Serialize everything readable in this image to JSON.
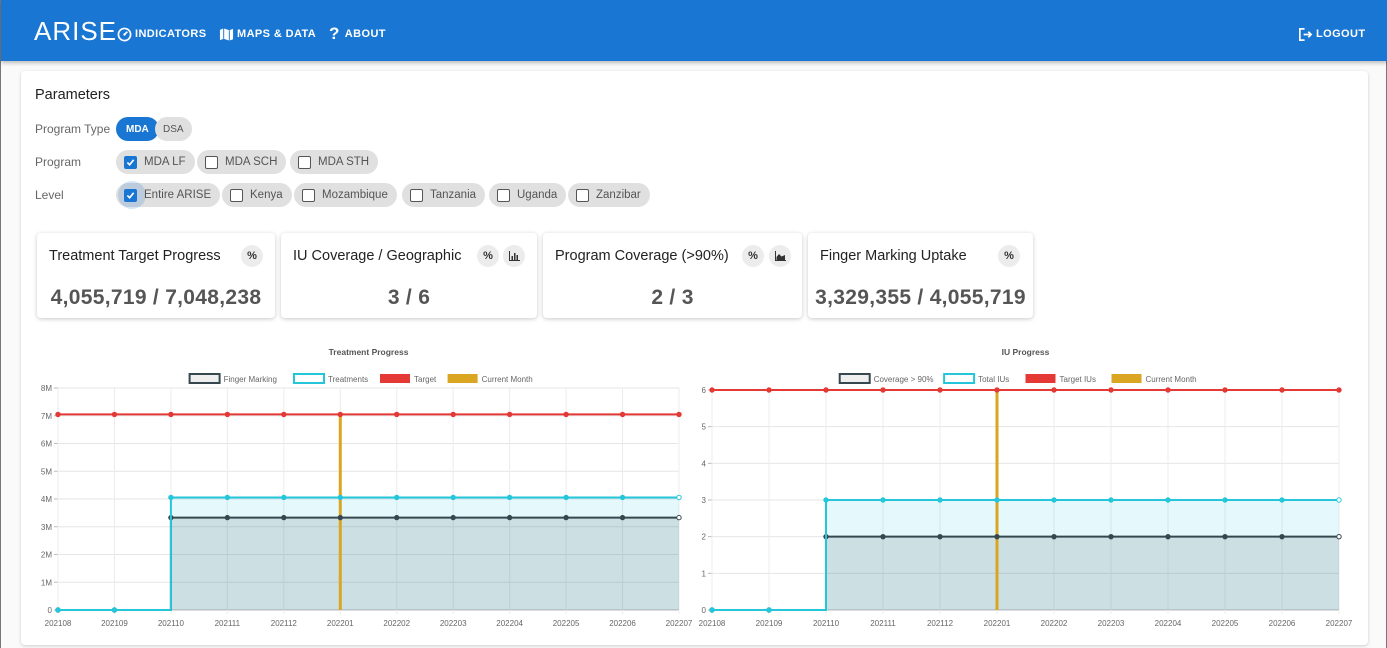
{
  "app": {
    "brand": "ARISE",
    "nav": [
      {
        "label": "INDICATORS",
        "icon": "dashboard-icon"
      },
      {
        "label": "MAPS & DATA",
        "icon": "map-icon"
      },
      {
        "label": "ABOUT",
        "icon": "question-icon"
      }
    ],
    "logout_label": "LOGOUT"
  },
  "params": {
    "title": "Parameters",
    "program_type_label": "Program Type",
    "program_types": [
      {
        "label": "MDA",
        "selected": true
      },
      {
        "label": "DSA",
        "selected": false
      }
    ],
    "program_label": "Program",
    "programs": [
      {
        "label": "MDA LF",
        "checked": true
      },
      {
        "label": "MDA SCH",
        "checked": false
      },
      {
        "label": "MDA STH",
        "checked": false
      }
    ],
    "level_label": "Level",
    "levels": [
      {
        "label": "Entire ARISE",
        "checked": true
      },
      {
        "label": "Kenya",
        "checked": false
      },
      {
        "label": "Mozambique",
        "checked": false
      },
      {
        "label": "Tanzania",
        "checked": false
      },
      {
        "label": "Uganda",
        "checked": false
      },
      {
        "label": "Zanzibar",
        "checked": false
      }
    ]
  },
  "stats": [
    {
      "title": "Treatment Target Progress",
      "value": "4,055,719 / 7,048,238",
      "buttons": [
        "percent-icon"
      ]
    },
    {
      "title": "IU Coverage / Geographic",
      "value": "3 / 6",
      "buttons": [
        "percent-icon",
        "bar-chart-icon"
      ]
    },
    {
      "title": "Program Coverage (>90%)",
      "value": "2 / 3",
      "buttons": [
        "percent-icon",
        "area-chart-icon"
      ]
    },
    {
      "title": "Finger Marking Uptake",
      "value": "3,329,355 / 4,055,719",
      "buttons": [
        "percent-icon"
      ]
    }
  ],
  "colors": {
    "primary": "#1976d2",
    "finger_marking": "#37474f",
    "treatments": "#26c6da",
    "target": "#e53935",
    "current_month": "#daa520"
  },
  "chart_data": [
    {
      "type": "line",
      "title": "Treatment Progress",
      "x": [
        "202108",
        "202109",
        "202110",
        "202111",
        "202112",
        "202201",
        "202202",
        "202203",
        "202204",
        "202205",
        "202206",
        "202207"
      ],
      "ylim": [
        0,
        8000000
      ],
      "y_ticks": [
        "0",
        "1M",
        "2M",
        "3M",
        "4M",
        "5M",
        "6M",
        "7M",
        "8M"
      ],
      "series": [
        {
          "name": "Finger Marking",
          "values": [
            0,
            0,
            3329355,
            3329355,
            3329355,
            3329355,
            3329355,
            3329355,
            3329355,
            3329355,
            3329355,
            3329355
          ],
          "color": "#37474f",
          "fill": true
        },
        {
          "name": "Treatments",
          "values": [
            0,
            0,
            4055719,
            4055719,
            4055719,
            4055719,
            4055719,
            4055719,
            4055719,
            4055719,
            4055719,
            4055719
          ],
          "color": "#26c6da",
          "fill": true
        },
        {
          "name": "Target",
          "values": [
            7048238,
            7048238,
            7048238,
            7048238,
            7048238,
            7048238,
            7048238,
            7048238,
            7048238,
            7048238,
            7048238,
            7048238
          ],
          "color": "#e53935",
          "fill": false
        },
        {
          "name": "Current Month",
          "x_value": "202201",
          "color": "#daa520"
        }
      ],
      "grid": true,
      "legend": "top"
    },
    {
      "type": "line",
      "title": "IU Progress",
      "x": [
        "202108",
        "202109",
        "202110",
        "202111",
        "202112",
        "202201",
        "202202",
        "202203",
        "202204",
        "202205",
        "202206",
        "202207"
      ],
      "ylim": [
        0,
        6
      ],
      "y_ticks": [
        "0",
        "1",
        "2",
        "3",
        "4",
        "5",
        "6"
      ],
      "series": [
        {
          "name": "Coverage > 90%",
          "values": [
            0,
            0,
            2,
            2,
            2,
            2,
            2,
            2,
            2,
            2,
            2,
            2
          ],
          "color": "#37474f",
          "fill": true
        },
        {
          "name": "Total IUs",
          "values": [
            0,
            0,
            3,
            3,
            3,
            3,
            3,
            3,
            3,
            3,
            3,
            3
          ],
          "color": "#26c6da",
          "fill": true
        },
        {
          "name": "Target IUs",
          "values": [
            6,
            6,
            6,
            6,
            6,
            6,
            6,
            6,
            6,
            6,
            6,
            6
          ],
          "color": "#e53935",
          "fill": false
        },
        {
          "name": "Current Month",
          "x_value": "202201",
          "color": "#daa520"
        }
      ],
      "grid": true,
      "legend": "top"
    }
  ]
}
